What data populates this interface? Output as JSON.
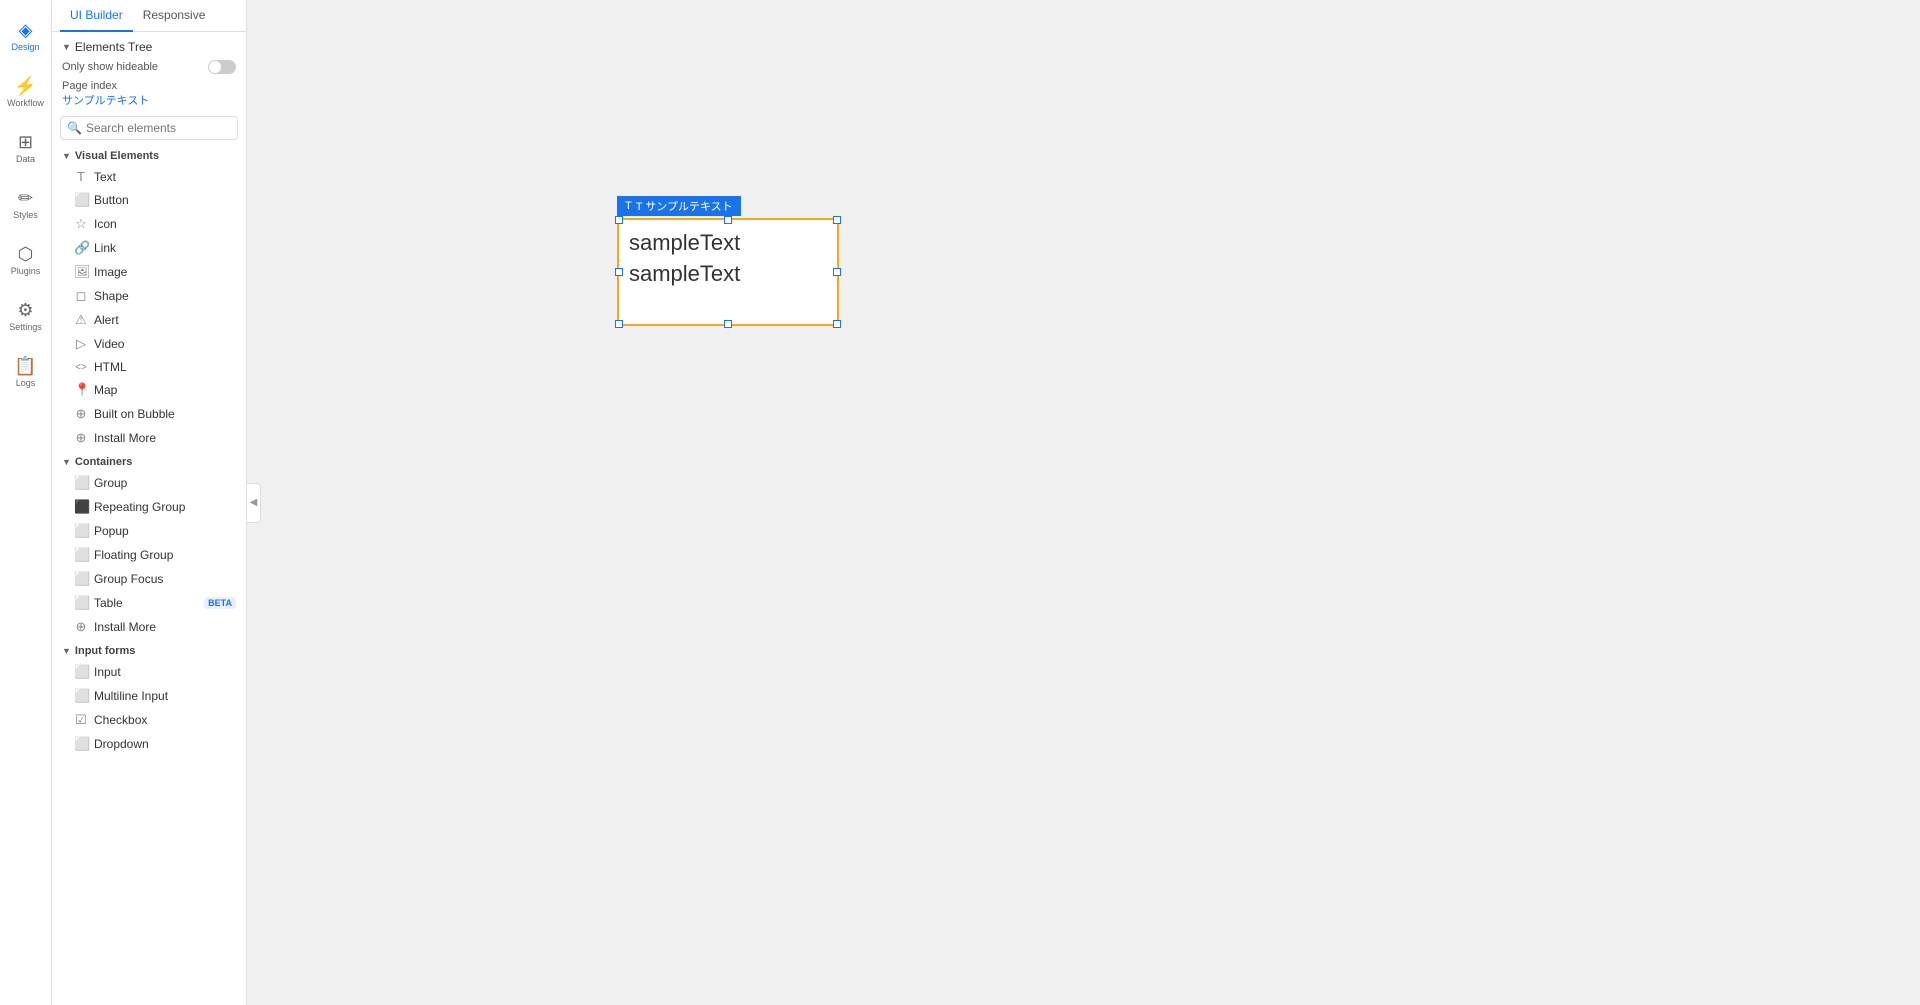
{
  "nav": {
    "items": [
      {
        "id": "design",
        "label": "Design",
        "icon": "◈",
        "active": true
      },
      {
        "id": "workflow",
        "label": "Workflow",
        "icon": "⚡",
        "active": false
      },
      {
        "id": "data",
        "label": "Data",
        "icon": "⊞",
        "active": false
      },
      {
        "id": "styles",
        "label": "Styles",
        "icon": "✏",
        "active": false
      },
      {
        "id": "plugins",
        "label": "Plugins",
        "icon": "⬡",
        "active": false
      },
      {
        "id": "settings",
        "label": "Settings",
        "icon": "⚙",
        "active": false
      },
      {
        "id": "logs",
        "label": "Logs",
        "icon": "📋",
        "active": false
      }
    ]
  },
  "panel": {
    "tabs": [
      {
        "id": "ui-builder",
        "label": "UI Builder",
        "active": true
      },
      {
        "id": "responsive",
        "label": "Responsive",
        "active": false
      }
    ],
    "elements_tree": {
      "label": "Elements Tree",
      "only_hideable": "Only show hideable",
      "page_index": "Page index",
      "page_name": "サンプルテキスト"
    },
    "search": {
      "placeholder": "Search elements"
    },
    "visual_elements": {
      "label": "Visual Elements",
      "items": [
        {
          "id": "text",
          "label": "Text",
          "icon": "T"
        },
        {
          "id": "button",
          "label": "Button",
          "icon": "⬜"
        },
        {
          "id": "icon",
          "label": "Icon",
          "icon": "☆"
        },
        {
          "id": "link",
          "label": "Link",
          "icon": "🔗"
        },
        {
          "id": "image",
          "label": "Image",
          "icon": "🖼"
        },
        {
          "id": "shape",
          "label": "Shape",
          "icon": "◻"
        },
        {
          "id": "alert",
          "label": "Alert",
          "icon": "⚠"
        },
        {
          "id": "video",
          "label": "Video",
          "icon": "▷"
        },
        {
          "id": "html",
          "label": "HTML",
          "icon": "<>"
        },
        {
          "id": "map",
          "label": "Map",
          "icon": "📍"
        },
        {
          "id": "built-on-bubble",
          "label": "Built on Bubble",
          "icon": "⊕"
        },
        {
          "id": "install-more-visual",
          "label": "Install More",
          "icon": "⊕"
        }
      ]
    },
    "containers": {
      "label": "Containers",
      "items": [
        {
          "id": "group",
          "label": "Group",
          "icon": "⬜"
        },
        {
          "id": "repeating-group",
          "label": "Repeating Group",
          "icon": "⬛"
        },
        {
          "id": "popup",
          "label": "Popup",
          "icon": "⬜"
        },
        {
          "id": "floating-group",
          "label": "Floating Group",
          "icon": "⬜"
        },
        {
          "id": "group-focus",
          "label": "Group Focus",
          "icon": "⬜"
        },
        {
          "id": "table",
          "label": "Table",
          "icon": "⬜",
          "beta": true
        },
        {
          "id": "install-more-containers",
          "label": "Install More",
          "icon": "⊕"
        }
      ]
    },
    "input_forms": {
      "label": "Input forms",
      "items": [
        {
          "id": "input",
          "label": "Input",
          "icon": "⬜"
        },
        {
          "id": "multiline-input",
          "label": "Multiline Input",
          "icon": "⬜"
        },
        {
          "id": "checkbox",
          "label": "Checkbox",
          "icon": "☑"
        },
        {
          "id": "dropdown",
          "label": "Dropdown",
          "icon": "⬜"
        }
      ]
    }
  },
  "canvas": {
    "text_element": {
      "label": "T サンプルテキスト",
      "content_line1": "sampleText",
      "content_line2": "sampleText"
    }
  },
  "beta_label": "BETA",
  "collapse_icon": "◀"
}
